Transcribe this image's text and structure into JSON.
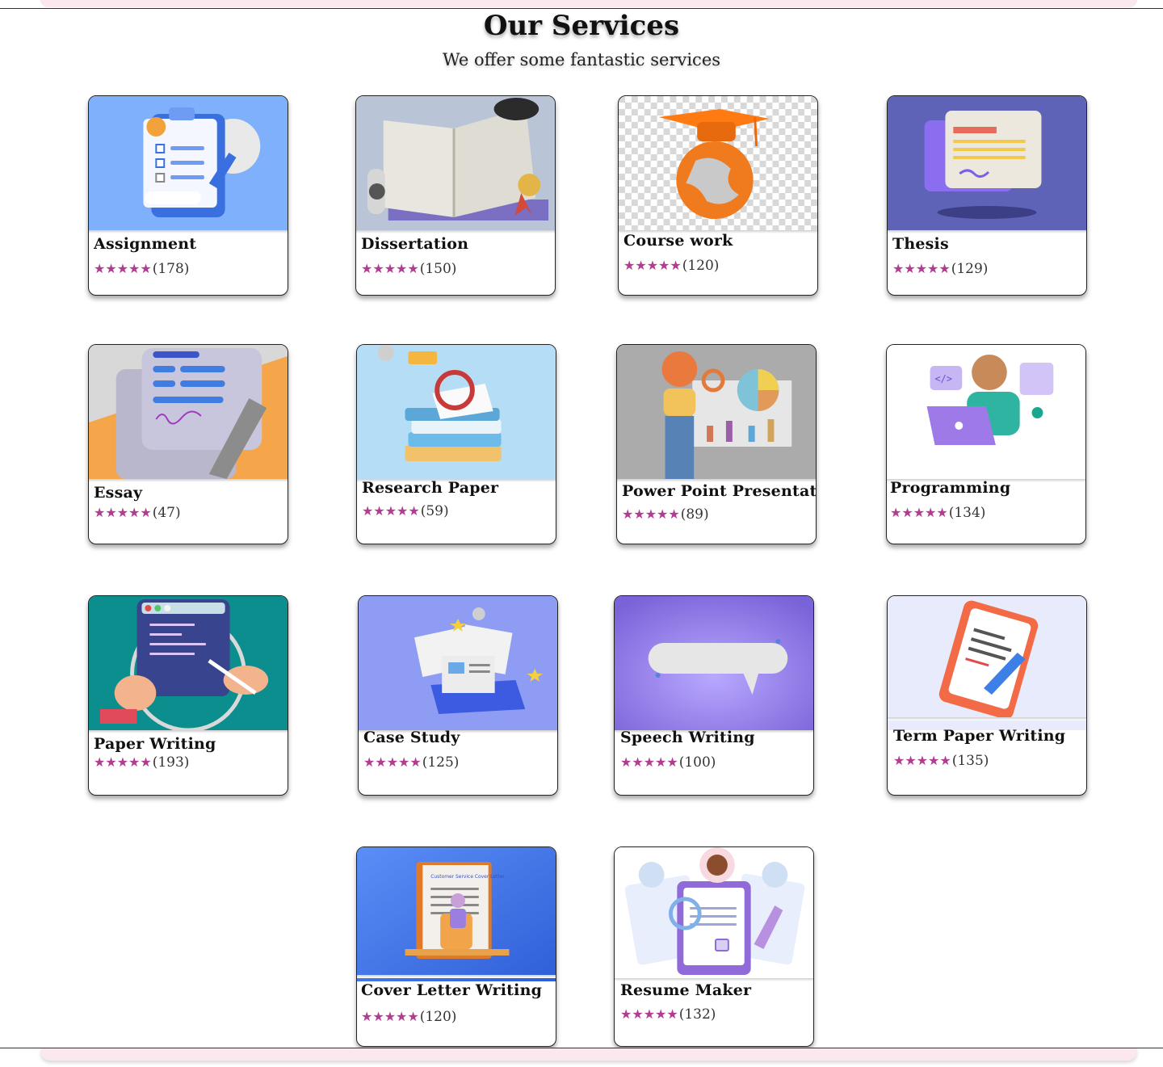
{
  "header": {
    "title": "Our Services",
    "subtitle": "We offer some fantastic services"
  },
  "theme": {
    "star_color": "#b23c8f",
    "band_color": "#fbe8ef"
  },
  "services": [
    {
      "name": "Assignment",
      "stars": "★★★★★",
      "count": "(178)",
      "icon": "clipboard-checklist-icon"
    },
    {
      "name": "Dissertation",
      "stars": "★★★★★",
      "count": "(150)",
      "icon": "open-book-icon"
    },
    {
      "name": "Course work",
      "stars": "★★★★★",
      "count": "(120)",
      "icon": "graduation-globe-icon"
    },
    {
      "name": "Thesis",
      "stars": "★★★★★",
      "count": "(129)",
      "icon": "document-stack-icon"
    },
    {
      "name": "Essay",
      "stars": "★★★★★",
      "count": "(47)",
      "icon": "signed-document-icon"
    },
    {
      "name": "Research Paper",
      "stars": "★★★★★",
      "count": "(59)",
      "icon": "books-magnifier-icon"
    },
    {
      "name": "Power Point Presentation",
      "stars": "★★★★★",
      "count": "(89)",
      "icon": "presenter-chart-icon"
    },
    {
      "name": "Programming",
      "stars": "★★★★★",
      "count": "(134)",
      "icon": "programmer-laptop-icon"
    },
    {
      "name": "Paper Writing",
      "stars": "★★★★★",
      "count": "(193)",
      "icon": "tablet-writing-icon"
    },
    {
      "name": "Case Study",
      "stars": "★★★★★",
      "count": "(125)",
      "icon": "newspapers-laptop-icon"
    },
    {
      "name": "Speech Writing",
      "stars": "★★★★★",
      "count": "(100)",
      "icon": "speech-bubble-icon"
    },
    {
      "name": "Term Paper Writing",
      "stars": "★★★★★",
      "count": "(135)",
      "icon": "notepad-pen-icon"
    },
    {
      "name": "Cover Letter Writing",
      "stars": "★★★★★",
      "count": "(120)",
      "icon": "cover-letter-icon"
    },
    {
      "name": "Resume Maker",
      "stars": "★★★★★",
      "count": "(132)",
      "icon": "resume-profiles-icon"
    }
  ],
  "cover_letter_art_text": "Customer Service Cover Letter"
}
